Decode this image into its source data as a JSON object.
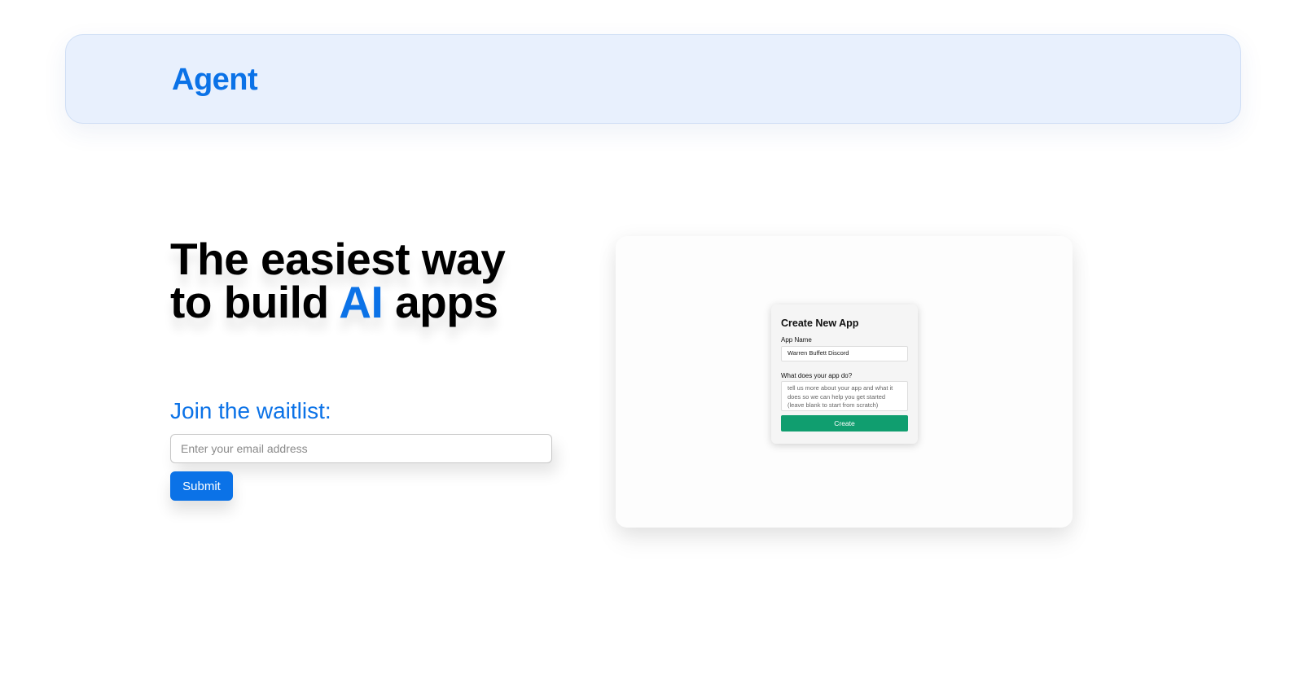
{
  "header": {
    "brand": "Agent"
  },
  "hero": {
    "title_line1": "The easiest way",
    "title_line2_prefix": "to build ",
    "title_line2_accent": "AI",
    "title_line2_suffix": " apps"
  },
  "waitlist": {
    "heading": "Join the waitlist:",
    "email_placeholder": "Enter your email address",
    "email_value": "",
    "submit_label": "Submit"
  },
  "preview": {
    "title": "Create New App",
    "app_name_label": "App Name",
    "app_name_value": "Warren Buffett Discord",
    "description_label": "What does your app do?",
    "description_placeholder": "tell us more about your app and what it does so we can help you get started (leave blank to start from scratch)",
    "create_label": "Create"
  },
  "colors": {
    "accent": "#0b72e7",
    "navbar_bg": "#e8f0fd",
    "create_button": "#109e6f"
  }
}
